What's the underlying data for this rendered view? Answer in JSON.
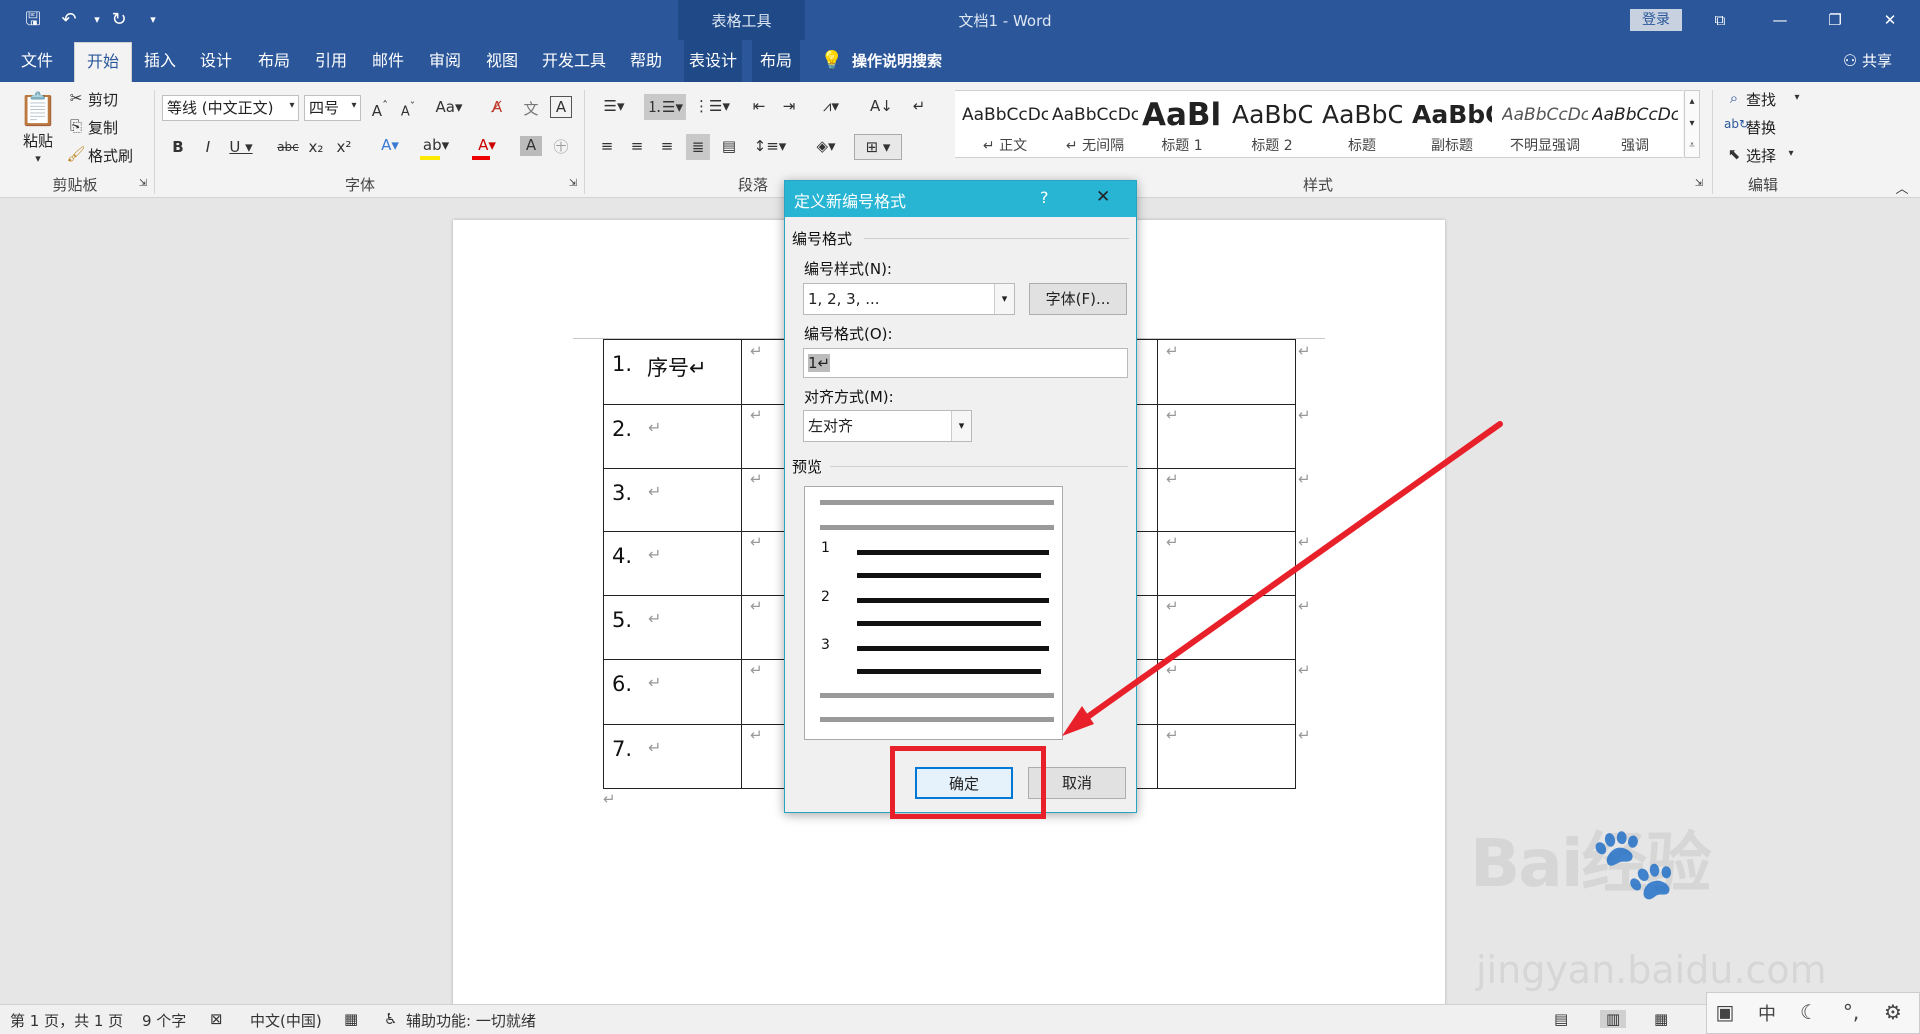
{
  "window": {
    "doc_title": "文档1 - Word",
    "context_tools_label": "表格工具",
    "login_label": "登录",
    "share_label": "共享"
  },
  "quick_access": [
    "save-icon",
    "undo-icon",
    "redo-icon",
    "customize-icon"
  ],
  "tabs": [
    {
      "label": "文件"
    },
    {
      "label": "开始"
    },
    {
      "label": "插入"
    },
    {
      "label": "设计"
    },
    {
      "label": "布局"
    },
    {
      "label": "引用"
    },
    {
      "label": "邮件"
    },
    {
      "label": "审阅"
    },
    {
      "label": "视图"
    },
    {
      "label": "开发工具"
    },
    {
      "label": "帮助"
    },
    {
      "label": "表设计"
    },
    {
      "label": "布局"
    }
  ],
  "tell_me": "操作说明搜索",
  "ribbon": {
    "clipboard": {
      "paste": "粘贴",
      "cut": "剪切",
      "copy": "复制",
      "format_painter": "格式刷",
      "group": "剪贴板"
    },
    "font": {
      "font_name": "等线 (中文正文)",
      "font_size": "四号",
      "group": "字体"
    },
    "paragraph": {
      "group": "段落"
    },
    "styles": {
      "group": "样式",
      "items": [
        {
          "preview": "AaBbCcDc",
          "name": "↵ 正文"
        },
        {
          "preview": "AaBbCcDc",
          "name": "↵ 无间隔"
        },
        {
          "preview": "AaBl",
          "name": "标题 1"
        },
        {
          "preview": "AaBbC",
          "name": "标题 2"
        },
        {
          "preview": "AaBbC",
          "name": "标题"
        },
        {
          "preview": "AaBbC",
          "name": "副标题"
        },
        {
          "preview": "AaBbCcDc",
          "name": "不明显强调"
        },
        {
          "preview": "AaBbCcDc",
          "name": "强调"
        }
      ]
    },
    "editing": {
      "find": "查找",
      "replace": "替换",
      "select": "选择",
      "group": "编辑"
    }
  },
  "table": {
    "rows": [
      {
        "num": "1.",
        "text": "序号↵"
      },
      {
        "num": "2.",
        "text": "↵"
      },
      {
        "num": "3.",
        "text": "↵"
      },
      {
        "num": "4.",
        "text": "↵"
      },
      {
        "num": "5.",
        "text": "↵"
      },
      {
        "num": "6.",
        "text": "↵"
      },
      {
        "num": "7.",
        "text": "↵"
      }
    ],
    "cell_mark": "↵"
  },
  "dialog": {
    "title": "定义新编号格式",
    "help": "?",
    "close": "✕",
    "section_number_format": "编号格式",
    "number_style_label": "编号样式(N):",
    "number_style_value": "1, 2, 3, ...",
    "font_button": "字体(F)...",
    "number_format_label": "编号格式(O):",
    "number_format_value": "1↵",
    "alignment_label": "对齐方式(M):",
    "alignment_value": "左对齐",
    "preview_label": "预览",
    "preview_numbers": [
      "1",
      "2",
      "3"
    ],
    "ok": "确定",
    "cancel": "取消"
  },
  "status": {
    "page": "第 1 页，共 1 页",
    "words": "9 个字",
    "language": "中文(中国)",
    "accessibility": "辅助功能: 一切就绪"
  },
  "ime": {
    "mode": "中"
  },
  "watermark": {
    "main": "Bai经验",
    "sub": "jingyan.baidu.com"
  },
  "colors": {
    "title_blue": "#2b579a",
    "dialog_title": "#27b5d3",
    "highlight_red": "#e8202a"
  }
}
